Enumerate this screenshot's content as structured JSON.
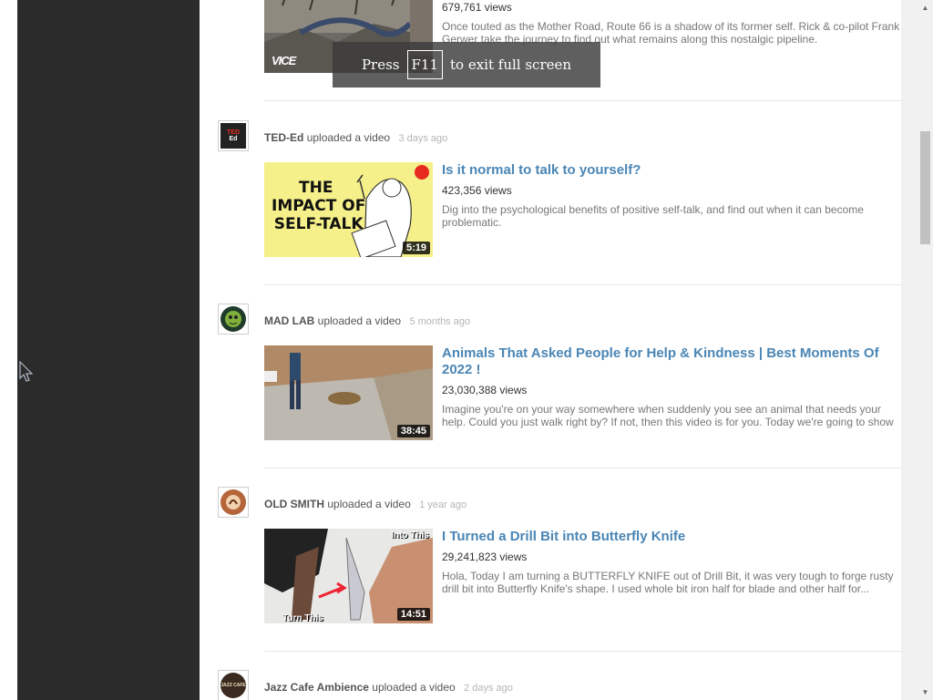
{
  "toast": {
    "press": "Press",
    "key": "F11",
    "rest": "to exit full screen"
  },
  "top_entry": {
    "views": "679,761 views",
    "description": "Once touted as the Mother Road, Route 66 is a shadow of its former self. Rick & co-pilot Frank Gerwer take the journey to find out what remains along this nostalgic pipeline.",
    "thumb_logo": "VICE"
  },
  "entries": [
    {
      "channel": "TED-Ed",
      "action": "uploaded a video",
      "ago": "3 days ago",
      "avatar_text": "TED Ed",
      "title": "Is it normal to talk to yourself?",
      "views": "423,356 views",
      "description": "Dig into the psychological benefits of positive self-talk, and find out when it can become problematic.",
      "duration": "5:19",
      "thumb_text": [
        "THE",
        "IMPACT OF",
        "SELF-TALK"
      ]
    },
    {
      "channel": "MAD LAB",
      "action": "uploaded a video",
      "ago": "5 months ago",
      "title": "Animals That Asked People for Help & Kindness | Best Moments Of 2022 !",
      "views": "23,030,388 views",
      "description": "Imagine you're on your way somewhere when suddenly you see an animal that needs your help. Could you just walk right by? If not, then this video is for you. Today we're going to show",
      "duration": "38:45"
    },
    {
      "channel": "OLD SMITH",
      "action": "uploaded a video",
      "ago": "1 year ago",
      "title": "I Turned a Drill Bit into Butterfly Knife",
      "views": "29,241,823 views",
      "description": "Hola, Today I am turning a BUTTERFLY KNIFE out of Drill Bit, it was very tough to forge rusty drill bit into Butterfly Knife's shape. I used whole bit iron half for blade and other half for...",
      "duration": "14:51",
      "thumb_text": [
        "Into This",
        "Turn This"
      ]
    },
    {
      "channel": "Jazz Cafe Ambience",
      "action": "uploaded a video",
      "ago": "2 days ago",
      "avatar_text": "JAZZ CAFE"
    }
  ],
  "colors": {
    "sidebar": "#2b2b2b",
    "title_link": "#4a86b5",
    "muted": "#b5b5b5"
  }
}
